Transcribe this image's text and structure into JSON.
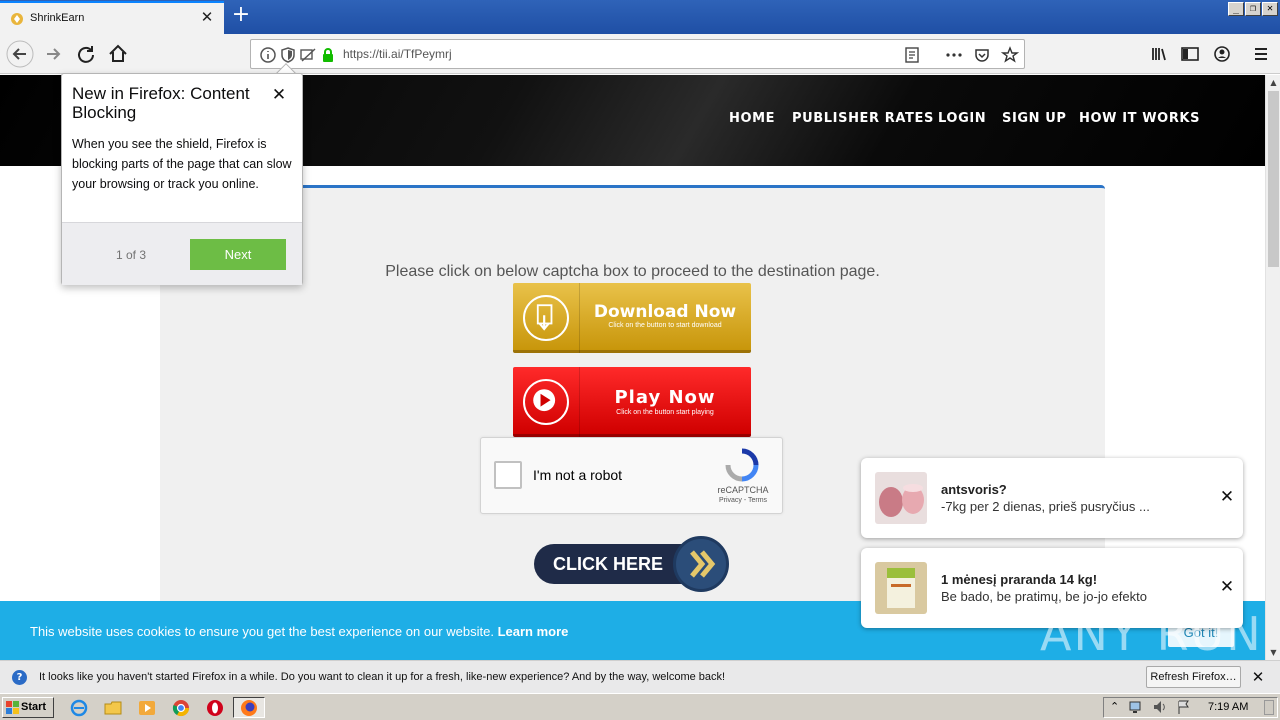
{
  "browser": {
    "tab": {
      "title": "ShrinkEarn"
    },
    "url": "https://tii.ai/TfPeymrj"
  },
  "site": {
    "nav": [
      {
        "label": "HOME"
      },
      {
        "label": "PUBLISHER RATES"
      },
      {
        "label": "LOGIN"
      },
      {
        "label": "SIGN UP"
      },
      {
        "label": "HOW IT WORKS"
      }
    ],
    "instruction": "Please click on below captcha box to proceed to the destination page.",
    "download_button": {
      "label": "Download Now",
      "sub": "Click on the button to start download"
    },
    "play_button": {
      "label": "Play Now",
      "sub": "Click on the button start playing"
    },
    "recaptcha": {
      "label": "I'm not a robot",
      "brand": "reCAPTCHA",
      "links": "Privacy - Terms"
    },
    "click_here": "CLICK HERE"
  },
  "cookie_bar": {
    "text": "This website uses cookies to ensure you get the best experience on our website.",
    "link": "Learn more",
    "button": "Got it!"
  },
  "notifications": [
    {
      "title": "antsvoris?",
      "body": "-7kg per 2 dienas, prieš pusryčius ..."
    },
    {
      "title": "1 mėnesį praranda 14 kg!",
      "body": "Be bado, be pratimų, be jo-jo efekto"
    }
  ],
  "doorhanger": {
    "title": "New in Firefox: Content Blocking",
    "body": "When you see the shield, Firefox is blocking parts of the page that can slow your browsing or track you online.",
    "step": "1 of 3",
    "next": "Next"
  },
  "infobar": {
    "text": "It looks like you haven't started Firefox in a while. Do you want to clean it up for a fresh, like-new experience? And by the way, welcome back!",
    "button": "Refresh Firefox…"
  },
  "taskbar": {
    "start": "Start",
    "clock": "7:19 AM"
  },
  "watermark": "ANY RUN",
  "colors": {
    "accent": "#2b74c7",
    "cookie_bar": "#1eaee6",
    "next_button": "#6dbd45",
    "download": "#d9a81f",
    "play": "#e80a0a"
  }
}
